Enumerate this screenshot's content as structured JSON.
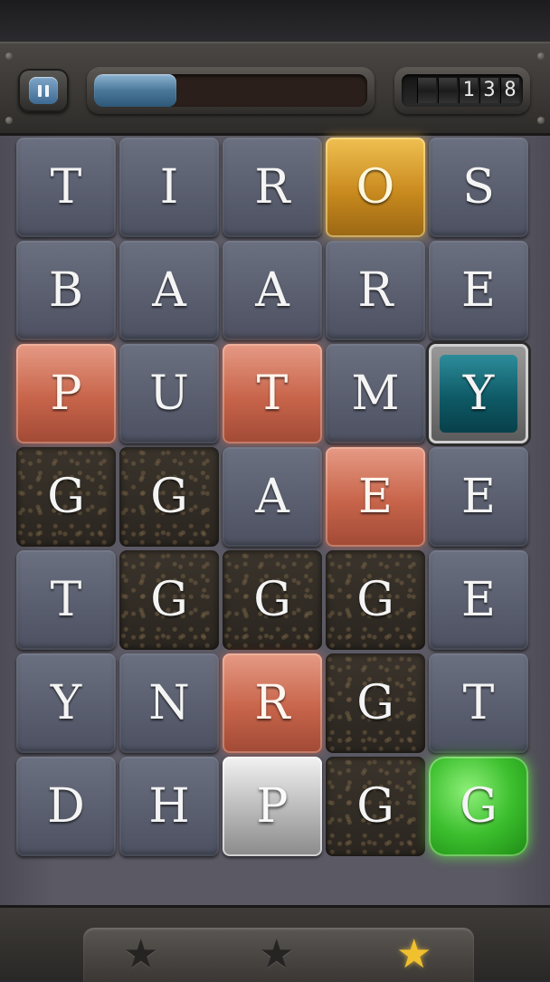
{
  "hud": {
    "pause_label": "II",
    "progress_value": 0.3,
    "score_digits": [
      "",
      "",
      "1",
      "3",
      "8"
    ]
  },
  "board": {
    "rows": [
      [
        {
          "letter": "T",
          "type": "normal"
        },
        {
          "letter": "I",
          "type": "normal"
        },
        {
          "letter": "R",
          "type": "normal"
        },
        {
          "letter": "O",
          "type": "gold"
        },
        {
          "letter": "S",
          "type": "normal"
        }
      ],
      [
        {
          "letter": "B",
          "type": "normal"
        },
        {
          "letter": "A",
          "type": "normal"
        },
        {
          "letter": "A",
          "type": "normal"
        },
        {
          "letter": "R",
          "type": "normal"
        },
        {
          "letter": "E",
          "type": "normal"
        }
      ],
      [
        {
          "letter": "P",
          "type": "copper"
        },
        {
          "letter": "U",
          "type": "normal"
        },
        {
          "letter": "T",
          "type": "copper"
        },
        {
          "letter": "M",
          "type": "normal"
        },
        {
          "letter": "Y",
          "type": "teal"
        }
      ],
      [
        {
          "letter": "G",
          "type": "dirt"
        },
        {
          "letter": "G",
          "type": "dirt"
        },
        {
          "letter": "A",
          "type": "normal"
        },
        {
          "letter": "E",
          "type": "copper"
        },
        {
          "letter": "E",
          "type": "normal"
        }
      ],
      [
        {
          "letter": "T",
          "type": "normal"
        },
        {
          "letter": "G",
          "type": "dirt"
        },
        {
          "letter": "G",
          "type": "dirt"
        },
        {
          "letter": "G",
          "type": "dirt"
        },
        {
          "letter": "E",
          "type": "normal"
        }
      ],
      [
        {
          "letter": "Y",
          "type": "normal"
        },
        {
          "letter": "N",
          "type": "normal"
        },
        {
          "letter": "R",
          "type": "copper"
        },
        {
          "letter": "G",
          "type": "dirt"
        },
        {
          "letter": "T",
          "type": "normal"
        }
      ],
      [
        {
          "letter": "D",
          "type": "normal"
        },
        {
          "letter": "H",
          "type": "normal"
        },
        {
          "letter": "P",
          "type": "silver"
        },
        {
          "letter": "G",
          "type": "dirt"
        },
        {
          "letter": "G",
          "type": "green"
        }
      ]
    ]
  },
  "stars": [
    {
      "icon": "star-icon",
      "filled": false
    },
    {
      "icon": "star-icon",
      "filled": false
    },
    {
      "icon": "star-icon",
      "filled": true
    }
  ],
  "colors": {
    "tile_normal": "#5c6070",
    "tile_copper": "#c7644a",
    "tile_gold": "#c98a1e",
    "tile_teal": "#0e5a66",
    "tile_green": "#3cbf2e",
    "star_on": "#f0c02e"
  }
}
